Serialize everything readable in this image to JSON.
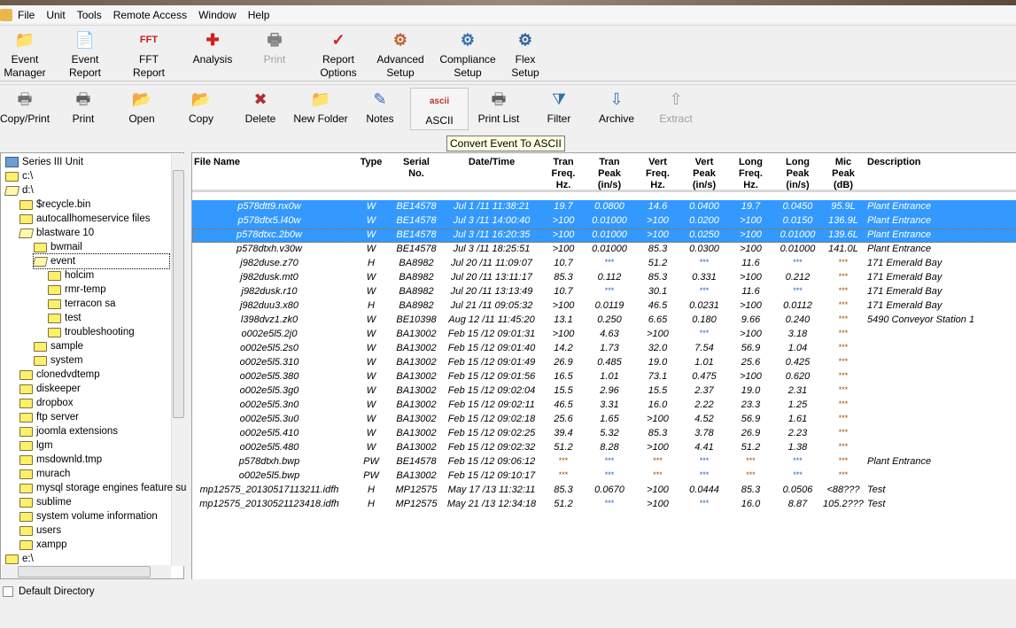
{
  "menu": [
    "File",
    "Unit",
    "Tools",
    "Remote Access",
    "Window",
    "Help"
  ],
  "toolbar1": [
    {
      "label1": "Event",
      "label2": "Manager",
      "icon": "folder-manager-icon",
      "glyph": "📁",
      "color": "#e0a020"
    },
    {
      "label1": "Event",
      "label2": "Report",
      "icon": "event-report-icon",
      "glyph": "📄",
      "color": "#d03030"
    },
    {
      "label1": "FFT",
      "label2": "Report",
      "icon": "fft-report-icon",
      "glyph": "FFT",
      "color": "#c02020"
    },
    {
      "label1": "Analysis",
      "label2": "",
      "icon": "analysis-magnifier-icon",
      "glyph": "✚",
      "color": "#d02020"
    },
    {
      "label1": "Print",
      "label2": "",
      "icon": "printer-icon",
      "glyph": "🖶",
      "color": "#808080",
      "disabled": true
    },
    {
      "label1": "Report",
      "label2": "Options",
      "icon": "report-options-icon",
      "glyph": "✓",
      "color": "#d02020"
    },
    {
      "label1": "Advanced",
      "label2": "Setup",
      "icon": "gears-icon",
      "glyph": "⚙",
      "color": "#c06030"
    },
    {
      "label1": "Compliance",
      "label2": "Setup",
      "icon": "gear-icon",
      "glyph": "⚙",
      "color": "#3070b0"
    },
    {
      "label1": "Flex",
      "label2": "Setup",
      "icon": "gear-plus-icon",
      "glyph": "⚙",
      "color": "#3060a0"
    }
  ],
  "toolbar2": [
    {
      "label": "Copy/Print",
      "icon": "copy-print-icon",
      "glyph": "🖶",
      "color": "#707070"
    },
    {
      "label": "Print",
      "icon": "printer-icon",
      "glyph": "🖶",
      "color": "#606060"
    },
    {
      "label": "Open",
      "icon": "open-folder-icon",
      "glyph": "📂",
      "color": "#d0a020"
    },
    {
      "label": "Copy",
      "icon": "copy-folder-icon",
      "glyph": "📂",
      "color": "#3060c0"
    },
    {
      "label": "Delete",
      "icon": "delete-x-icon",
      "glyph": "✖",
      "color": "#b03030"
    },
    {
      "label": "New Folder",
      "icon": "new-folder-icon",
      "glyph": "📁",
      "color": "#e0b020"
    },
    {
      "label": "Notes",
      "icon": "notes-icon",
      "glyph": "✎",
      "color": "#3060c0"
    },
    {
      "label": "ASCII",
      "icon": "ascii-icon",
      "glyph": "ascii",
      "color": "#c03030",
      "pressed": true
    },
    {
      "label": "Print List",
      "icon": "print-list-icon",
      "glyph": "🖶",
      "color": "#606060"
    },
    {
      "label": "Filter",
      "icon": "filter-icon",
      "glyph": "⧩",
      "color": "#3070b0"
    },
    {
      "label": "Archive",
      "icon": "archive-icon",
      "glyph": "⇩",
      "color": "#3070b0"
    },
    {
      "label": "Extract",
      "icon": "extract-icon",
      "glyph": "⇧",
      "color": "#a0a0a0",
      "disabled": true
    }
  ],
  "tooltip": "Convert Event To ASCII",
  "tree": [
    {
      "label": "Series III Unit",
      "level": 0,
      "kind": "unit"
    },
    {
      "label": "c:\\",
      "level": 0,
      "kind": "folder"
    },
    {
      "label": "d:\\",
      "level": 0,
      "kind": "open"
    },
    {
      "label": "$recycle.bin",
      "level": 1,
      "kind": "folder"
    },
    {
      "label": "autocallhomeservice files",
      "level": 1,
      "kind": "folder"
    },
    {
      "label": "blastware 10",
      "level": 1,
      "kind": "open"
    },
    {
      "label": "bwmail",
      "level": 2,
      "kind": "folder"
    },
    {
      "label": "event",
      "level": 2,
      "kind": "open",
      "focused": true
    },
    {
      "label": "holcim",
      "level": 3,
      "kind": "folder"
    },
    {
      "label": "rmr-temp",
      "level": 3,
      "kind": "folder"
    },
    {
      "label": "terracon sa",
      "level": 3,
      "kind": "folder"
    },
    {
      "label": "test",
      "level": 3,
      "kind": "folder"
    },
    {
      "label": "troubleshooting",
      "level": 3,
      "kind": "folder"
    },
    {
      "label": "sample",
      "level": 2,
      "kind": "folder"
    },
    {
      "label": "system",
      "level": 2,
      "kind": "folder"
    },
    {
      "label": "clonedvdtemp",
      "level": 1,
      "kind": "folder"
    },
    {
      "label": "diskeeper",
      "level": 1,
      "kind": "folder"
    },
    {
      "label": "dropbox",
      "level": 1,
      "kind": "folder"
    },
    {
      "label": "ftp server",
      "level": 1,
      "kind": "folder"
    },
    {
      "label": "joomla extensions",
      "level": 1,
      "kind": "folder"
    },
    {
      "label": "lgm",
      "level": 1,
      "kind": "folder"
    },
    {
      "label": "msdownld.tmp",
      "level": 1,
      "kind": "folder"
    },
    {
      "label": "murach",
      "level": 1,
      "kind": "folder"
    },
    {
      "label": "mysql storage engines feature su",
      "level": 1,
      "kind": "folder"
    },
    {
      "label": "sublime",
      "level": 1,
      "kind": "folder"
    },
    {
      "label": "system volume information",
      "level": 1,
      "kind": "folder"
    },
    {
      "label": "users",
      "level": 1,
      "kind": "folder"
    },
    {
      "label": "xampp",
      "level": 1,
      "kind": "folder"
    },
    {
      "label": "e:\\",
      "level": 0,
      "kind": "folder"
    }
  ],
  "columns": [
    "File Name",
    "Type",
    "Serial\nNo.",
    "Date/Time",
    "Tran\nFreq.\nHz.",
    "Tran\nPeak\n(in/s)",
    "Vert\nFreq.\nHz.",
    "Vert\nPeak\n(in/s)",
    "Long\nFreq.\nHz.",
    "Long\nPeak\n(in/s)",
    "Mic\nPeak\n(dB)",
    "Description"
  ],
  "rows": [
    [
      "p578dtt9.nx0w",
      "W",
      "BE14578",
      "Jul 1 /11  11:38:21",
      "19.7",
      "0.0800",
      "14.6",
      "0.0400",
      "19.7",
      "0.0450",
      "95.9L",
      "Plant Entrance"
    ],
    [
      "p578dtx5.l40w",
      "W",
      "BE14578",
      "Jul 3 /11  14:00:40",
      ">100",
      "0.01000",
      ">100",
      "0.0200",
      ">100",
      "0.0150",
      "136.9L",
      "Plant Entrance"
    ],
    [
      "p578dtxc.2b0w",
      "W",
      "BE14578",
      "Jul 3 /11  16:20:35",
      ">100",
      "0.01000",
      ">100",
      "0.0250",
      ">100",
      "0.01000",
      "139.6L",
      "Plant Entrance"
    ],
    [
      "p578dtxh.v30w",
      "W",
      "BE14578",
      "Jul 3 /11  18:25:51",
      ">100",
      "0.01000",
      "85.3",
      "0.0300",
      ">100",
      "0.01000",
      "141.0L",
      "Plant Entrance"
    ],
    [
      "j982duse.z70",
      "H",
      "BA8982",
      "Jul 20 /11  11:09:07",
      "10.7",
      "***",
      "51.2",
      "***",
      "11.6",
      "***",
      "***",
      "171 Emerald Bay"
    ],
    [
      "j982dusk.mt0",
      "W",
      "BA8982",
      "Jul 20 /11  13:11:17",
      "85.3",
      "0.112",
      "85.3",
      "0.331",
      ">100",
      "0.212",
      "***",
      "171 Emerald Bay"
    ],
    [
      "j982dusk.r10",
      "W",
      "BA8982",
      "Jul 20 /11  13:13:49",
      "10.7",
      "***",
      "30.1",
      "***",
      "11.6",
      "***",
      "***",
      "171 Emerald Bay"
    ],
    [
      "j982duu3.x80",
      "H",
      "BA8982",
      "Jul 21 /11  09:05:32",
      ">100",
      "0.0119",
      "46.5",
      "0.0231",
      ">100",
      "0.0112",
      "***",
      "171 Emerald Bay"
    ],
    [
      "l398dvz1.zk0",
      "W",
      "BE10398",
      "Aug 12 /11  11:45:20",
      "13.1",
      "0.250",
      "6.65",
      "0.180",
      "9.66",
      "0.240",
      "***",
      "5490 Conveyor Station 1"
    ],
    [
      "o002e5l5.2j0",
      "W",
      "BA13002",
      "Feb 15 /12  09:01:31",
      ">100",
      "4.63",
      ">100",
      "***",
      ">100",
      "3.18",
      "***",
      ""
    ],
    [
      "o002e5l5.2s0",
      "W",
      "BA13002",
      "Feb 15 /12  09:01:40",
      "14.2",
      "1.73",
      "32.0",
      "7.54",
      "56.9",
      "1.04",
      "***",
      ""
    ],
    [
      "o002e5l5.310",
      "W",
      "BA13002",
      "Feb 15 /12  09:01:49",
      "26.9",
      "0.485",
      "19.0",
      "1.01",
      "25.6",
      "0.425",
      "***",
      ""
    ],
    [
      "o002e5l5.380",
      "W",
      "BA13002",
      "Feb 15 /12  09:01:56",
      "16.5",
      "1.01",
      "73.1",
      "0.475",
      ">100",
      "0.620",
      "***",
      ""
    ],
    [
      "o002e5l5.3g0",
      "W",
      "BA13002",
      "Feb 15 /12  09:02:04",
      "15.5",
      "2.96",
      "15.5",
      "2.37",
      "19.0",
      "2.31",
      "***",
      ""
    ],
    [
      "o002e5l5.3n0",
      "W",
      "BA13002",
      "Feb 15 /12  09:02:11",
      "46.5",
      "3.31",
      "16.0",
      "2.22",
      "23.3",
      "1.25",
      "***",
      ""
    ],
    [
      "o002e5l5.3u0",
      "W",
      "BA13002",
      "Feb 15 /12  09:02:18",
      "25.6",
      "1.65",
      ">100",
      "4.52",
      "56.9",
      "1.61",
      "***",
      ""
    ],
    [
      "o002e5l5.410",
      "W",
      "BA13002",
      "Feb 15 /12  09:02:25",
      "39.4",
      "5.32",
      "85.3",
      "3.78",
      "26.9",
      "2.23",
      "***",
      ""
    ],
    [
      "o002e5l5.480",
      "W",
      "BA13002",
      "Feb 15 /12  09:02:32",
      "51.2",
      "8.28",
      ">100",
      "4.41",
      "51.2",
      "1.38",
      "***",
      ""
    ],
    [
      "p578dtxh.bwp",
      "PW",
      "BE14578",
      "Feb 15 /12  09:06:12",
      "***",
      "***",
      "***",
      "***",
      "***",
      "***",
      "***",
      "Plant Entrance"
    ],
    [
      "o002e5l5.bwp",
      "PW",
      "BA13002",
      "Feb 15 /12  09:10:17",
      "***",
      "***",
      "***",
      "***",
      "***",
      "***",
      "***",
      ""
    ],
    [
      "mp12575_20130517113211.idfh",
      "H",
      "MP12575",
      "May 17 /13  11:32:11",
      "85.3",
      "0.0670",
      ">100",
      "0.0444",
      "85.3",
      "0.0506",
      "<88???",
      "Test"
    ],
    [
      "mp12575_20130521123418.idfh",
      "H",
      "MP12575",
      "May 21 /13  12:34:18",
      "51.2",
      "***",
      ">100",
      "***",
      "16.0",
      "8.87",
      "105.2???",
      "Test"
    ]
  ],
  "selected_rows": [
    0,
    1,
    2
  ],
  "focused_row": 2,
  "default_directory_label": "Default Directory",
  "default_directory_checked": false,
  "colors": {
    "selection": "#3399ff",
    "asterisk_peak": "#2a60c0",
    "asterisk_other": "#a05000"
  }
}
